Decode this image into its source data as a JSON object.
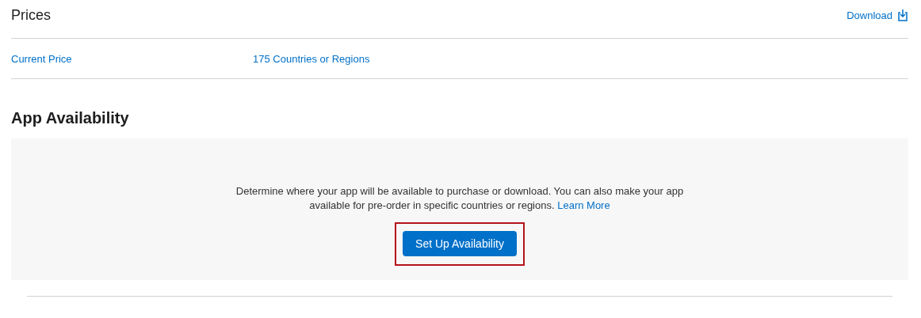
{
  "prices": {
    "title": "Prices",
    "download_link": "Download",
    "rows": [
      {
        "label": "Current Price",
        "value": "175 Countries or Regions"
      }
    ]
  },
  "app_availability": {
    "title": "App Availability",
    "description": "Determine where your app will be available to purchase or download. You can also make your app available for pre-order in specific countries or regions.",
    "learn_more_link": "Learn More",
    "button": {
      "label": "Set Up Availability",
      "highlighted": true
    }
  }
}
